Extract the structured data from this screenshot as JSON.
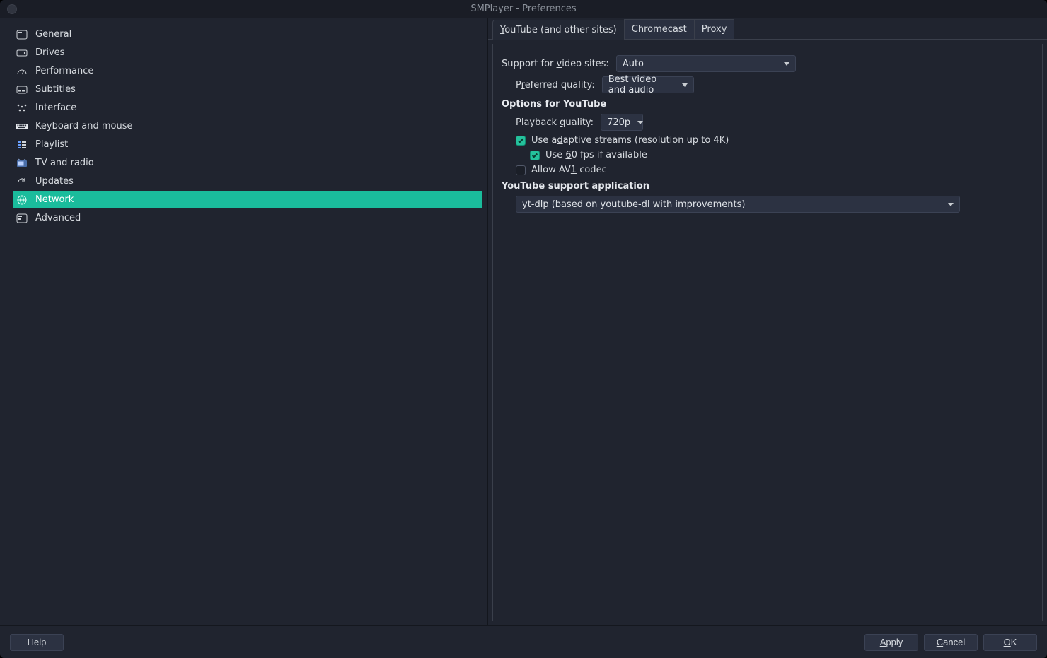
{
  "window": {
    "title": "SMPlayer - Preferences"
  },
  "sidebar": {
    "items": [
      {
        "icon": "settings-window-icon",
        "label": "General"
      },
      {
        "icon": "disk-icon",
        "label": "Drives"
      },
      {
        "icon": "gauge-icon",
        "label": "Performance"
      },
      {
        "icon": "subtitles-icon",
        "label": "Subtitles"
      },
      {
        "icon": "interface-icon",
        "label": "Interface"
      },
      {
        "icon": "keyboard-icon",
        "label": "Keyboard and mouse"
      },
      {
        "icon": "playlist-icon",
        "label": "Playlist"
      },
      {
        "icon": "tv-icon",
        "label": "TV and radio"
      },
      {
        "icon": "update-icon",
        "label": "Updates"
      },
      {
        "icon": "globe-icon",
        "label": "Network",
        "selected": true
      },
      {
        "icon": "advanced-icon",
        "label": "Advanced"
      }
    ]
  },
  "tabs": [
    {
      "id": "youtube",
      "label": "YouTube (and other sites)",
      "active": true
    },
    {
      "id": "chromecast",
      "label": "Chromecast"
    },
    {
      "id": "proxy",
      "label": "Proxy"
    }
  ],
  "form": {
    "support_label": "Support for video sites:",
    "support_value": "Auto",
    "preferred_label": "Preferred quality:",
    "preferred_value": "Best video and audio",
    "options_title": "Options for YouTube",
    "playback_label": "Playback quality:",
    "playback_value": "720p",
    "adaptive_label": "Use adaptive streams (resolution up to 4K)",
    "adaptive_checked": true,
    "fps60_label": "Use 60 fps if available",
    "fps60_checked": true,
    "av1_label": "Allow AV1 codec",
    "av1_checked": false,
    "yt_support_title": "YouTube support application",
    "yt_support_value": "yt-dlp (based on youtube-dl with improvements)"
  },
  "footer": {
    "help": "Help",
    "apply": "Apply",
    "cancel": "Cancel",
    "ok": "OK"
  }
}
